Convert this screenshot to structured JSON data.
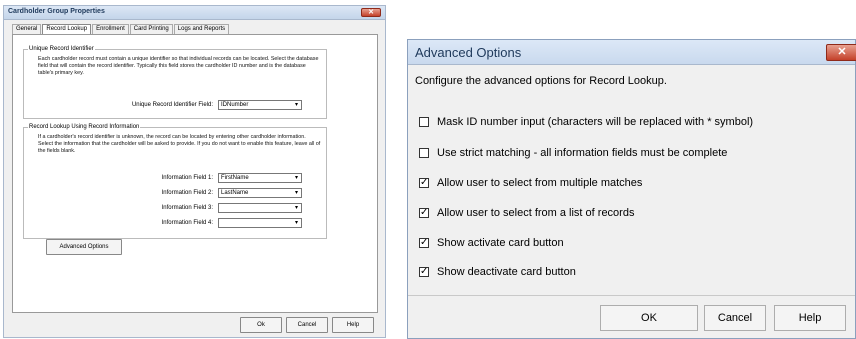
{
  "left_dialog": {
    "title": "Cardholder Group Properties",
    "close_glyph": "✕",
    "tabs": [
      "General",
      "Record Lookup",
      "Enrollment",
      "Card Printing",
      "Logs and Reports"
    ],
    "unique_group": {
      "legend": "Unique Record Identifier",
      "description": "Each cardholder record must contain a unique identifier so that individual records can be located. Select the database field that will contain the record identifier. Typically this field stores the cardholder ID number and is the database table's primary key.",
      "field_label": "Unique Record Identifier Field:",
      "field_value": "IDNumber"
    },
    "lookup_group": {
      "legend": "Record Lookup Using Record Information",
      "description": "If a cardholder's record identifier is unknown, the record can be located by entering other cardholder information. Select the information that the cardholder will be asked to provide. If you do not want to enable this feature, leave all of the fields blank.",
      "fields": [
        {
          "label": "Information Field 1:",
          "value": "FirstName"
        },
        {
          "label": "Information Field 2:",
          "value": "LastName"
        },
        {
          "label": "Information Field 3:",
          "value": ""
        },
        {
          "label": "Information Field 4:",
          "value": ""
        }
      ]
    },
    "advanced_button": "Advanced Options",
    "buttons": {
      "ok": "Ok",
      "cancel": "Cancel",
      "help": "Help"
    }
  },
  "right_dialog": {
    "title": "Advanced Options",
    "close_glyph": "✕",
    "intro": "Configure the advanced options for Record Lookup.",
    "options": [
      {
        "label": "Mask ID number input (characters will be replaced with * symbol)",
        "checked": false,
        "mark": ""
      },
      {
        "label": "Use strict matching - all information fields must be complete",
        "checked": false,
        "mark": ""
      },
      {
        "label": "Allow user to select from multiple matches",
        "checked": true,
        "mark": "✓"
      },
      {
        "label": "Allow user to select from a list of records",
        "checked": true,
        "mark": "✓"
      },
      {
        "label": "Show activate card button",
        "checked": true,
        "mark": "✓"
      },
      {
        "label": "Show deactivate card button",
        "checked": true,
        "mark": "✓"
      }
    ],
    "buttons": {
      "ok": "OK",
      "cancel": "Cancel",
      "help": "Help"
    }
  },
  "colors": {
    "close_button": "#c4412a",
    "title_text": "#1e395b"
  }
}
